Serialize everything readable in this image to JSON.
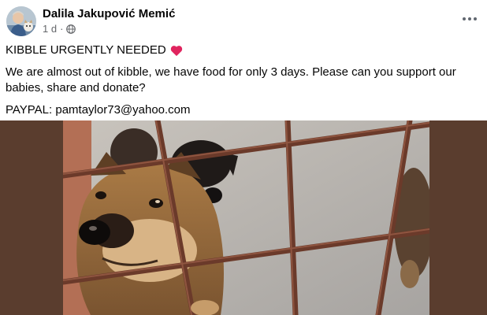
{
  "post": {
    "author": "Dalila Jakupović Memić",
    "time": "1 d",
    "separator": "·",
    "privacy_icon": "globe-icon",
    "more_icon": "more-horizontal-icon",
    "headline": "KIBBLE URGENTLY NEEDED",
    "headline_emoji": "heart-icon",
    "message": "We are almost out of kibble, we have food for only 3 days. Please can you support our babies, share and donate?",
    "paypal": "PAYPAL: pamtaylor73@yahoo.com",
    "photo_icon": "dog-photo"
  },
  "colors": {
    "heart": "#e0245e",
    "secondary_text": "#65676b",
    "media_background": "#5a3d2e"
  }
}
